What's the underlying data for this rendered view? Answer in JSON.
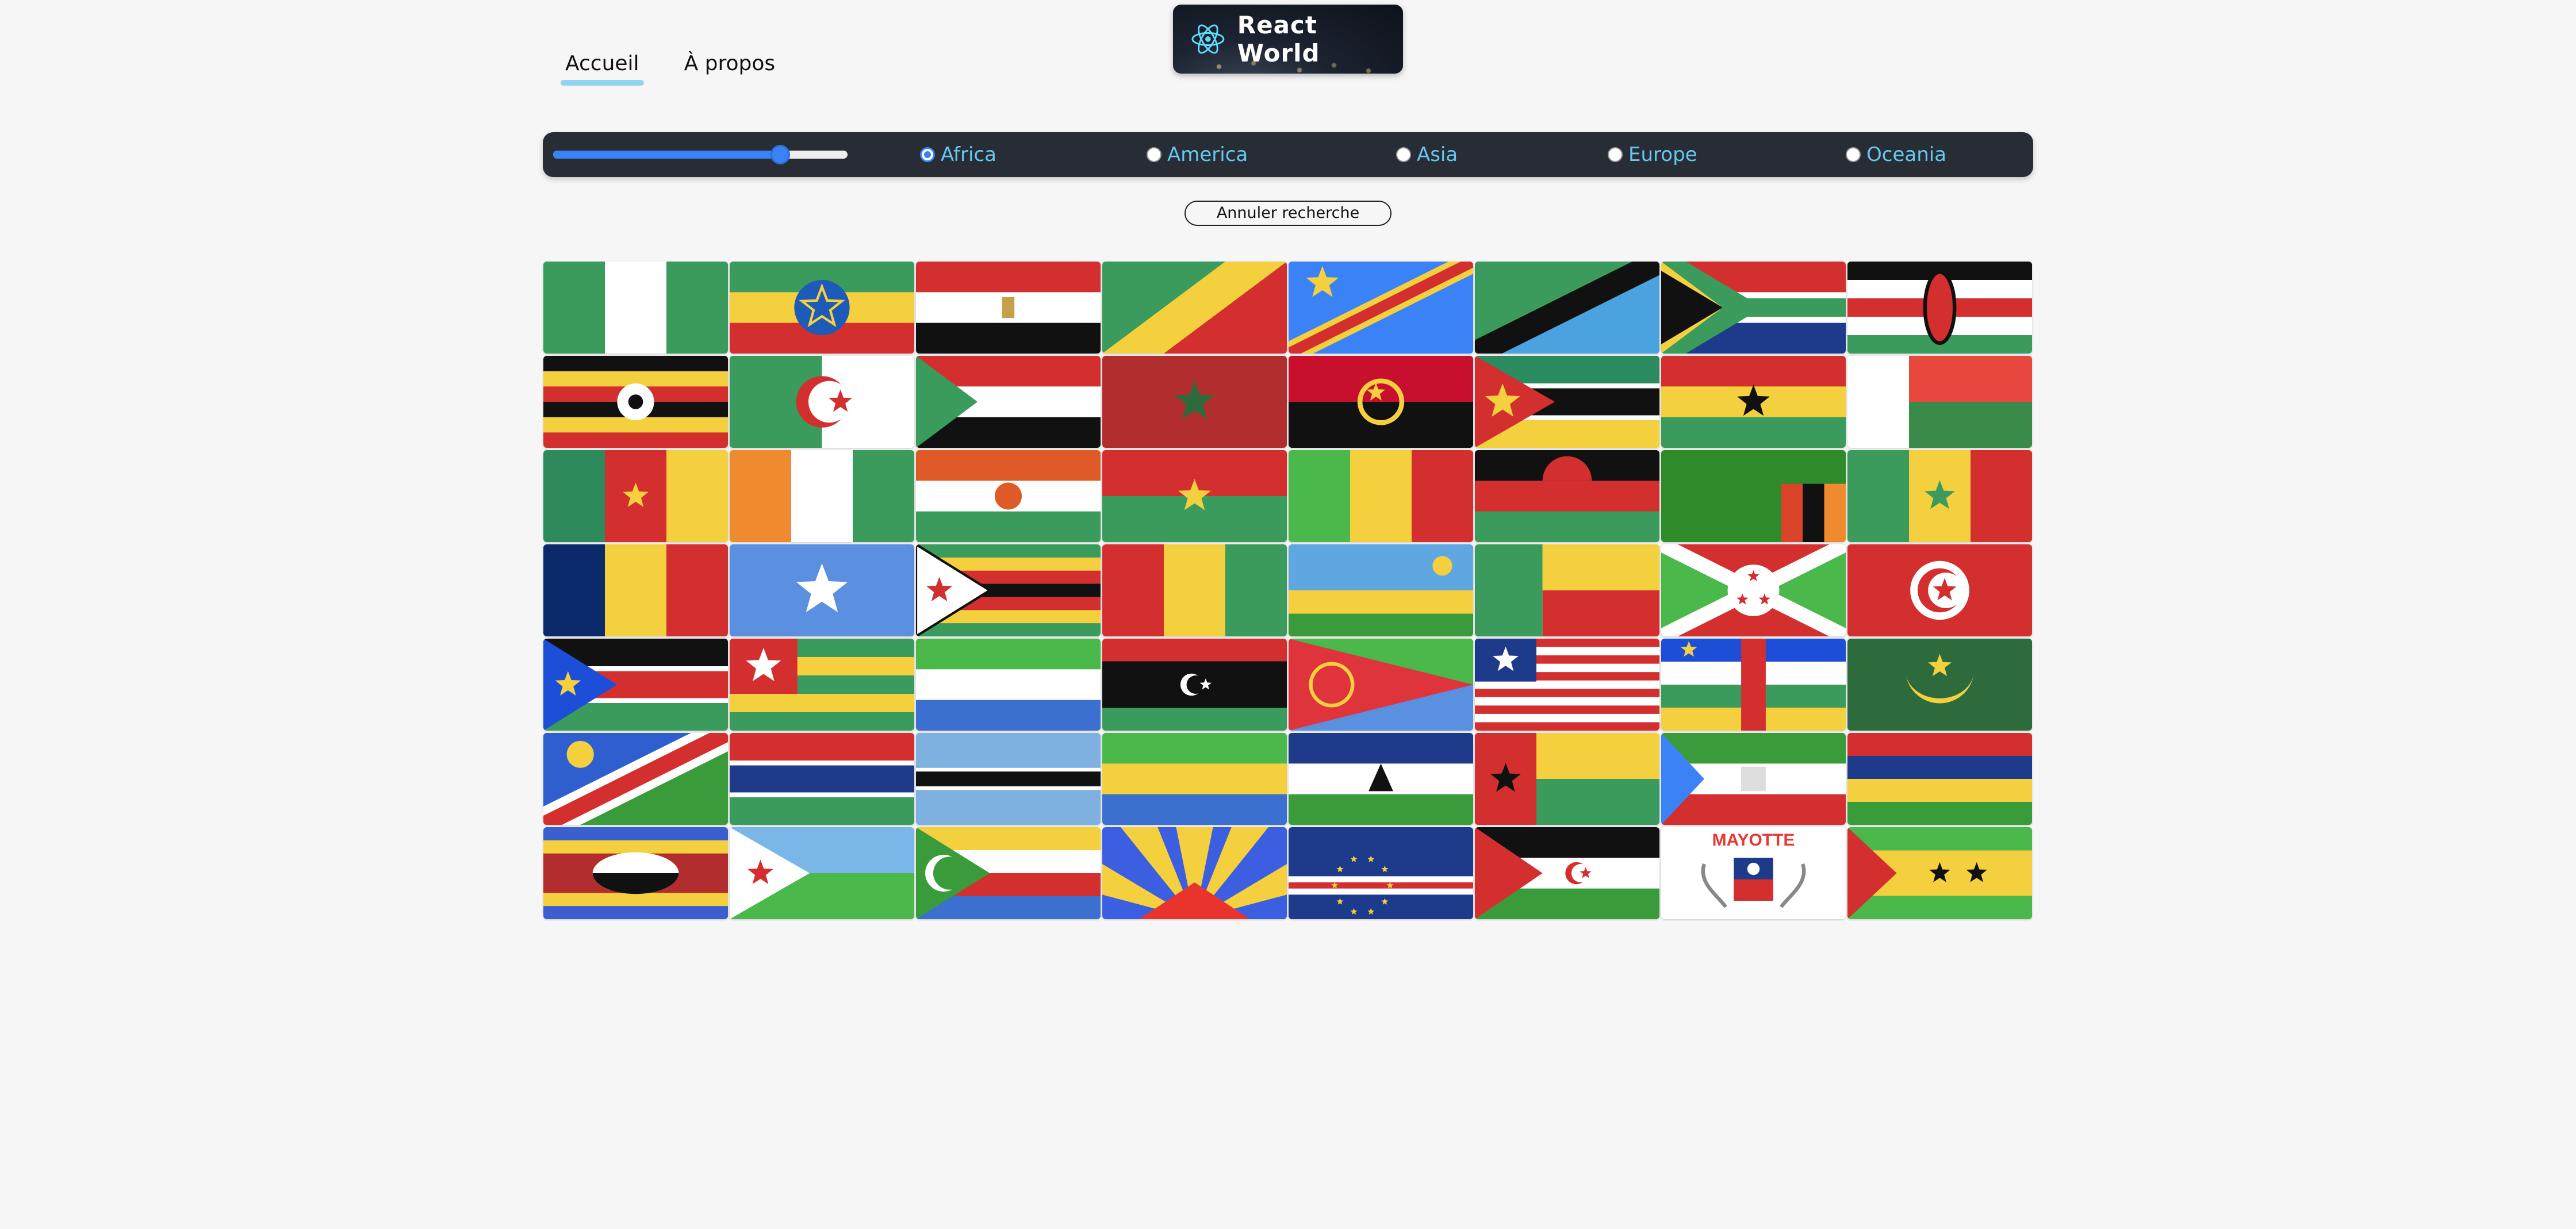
{
  "nav": {
    "home": "Accueil",
    "about": "À propos"
  },
  "logo": {
    "text": "React World",
    "icon": "react-atom-icon",
    "accent": "#61dafb"
  },
  "filters": {
    "slider": {
      "min": 0,
      "max": 250,
      "value": 200
    },
    "continents": [
      {
        "label": "Africa",
        "checked": true
      },
      {
        "label": "America",
        "checked": false
      },
      {
        "label": "Asia",
        "checked": false
      },
      {
        "label": "Europe",
        "checked": false
      },
      {
        "label": "Oceania",
        "checked": false
      }
    ]
  },
  "cancel_label": "Annuler recherche",
  "flags": [
    "nigeria-flag",
    "ethiopia-flag",
    "egypt-flag",
    "congo-flag",
    "dr-congo-flag",
    "tanzania-flag",
    "south-africa-flag",
    "kenya-flag",
    "uganda-flag",
    "algeria-flag",
    "sudan-flag",
    "morocco-flag",
    "angola-flag",
    "mozambique-flag",
    "ghana-flag",
    "madagascar-flag",
    "cameroon-flag",
    "ivory-coast-flag",
    "niger-flag",
    "burkina-faso-flag",
    "mali-flag",
    "malawi-flag",
    "zambia-flag",
    "senegal-flag",
    "chad-flag",
    "somalia-flag",
    "zimbabwe-flag",
    "guinea-flag",
    "rwanda-flag",
    "benin-flag",
    "burundi-flag",
    "tunisia-flag",
    "south-sudan-flag",
    "togo-flag",
    "sierra-leone-flag",
    "libya-flag",
    "eritrea-flag",
    "liberia-flag",
    "central-african-republic-flag",
    "mauritania-flag",
    "namibia-flag",
    "gambia-flag",
    "botswana-flag",
    "gabon-flag",
    "lesotho-flag",
    "guinea-bissau-flag",
    "equatorial-guinea-flag",
    "mauritius-flag",
    "eswatini-flag",
    "djibouti-flag",
    "comoros-flag",
    "reunion-flag",
    "cape-verde-flag",
    "western-sahara-flag",
    "mayotte-flag",
    "sao-tome-and-principe-flag"
  ],
  "mayotte_text": "MAYOTTE"
}
